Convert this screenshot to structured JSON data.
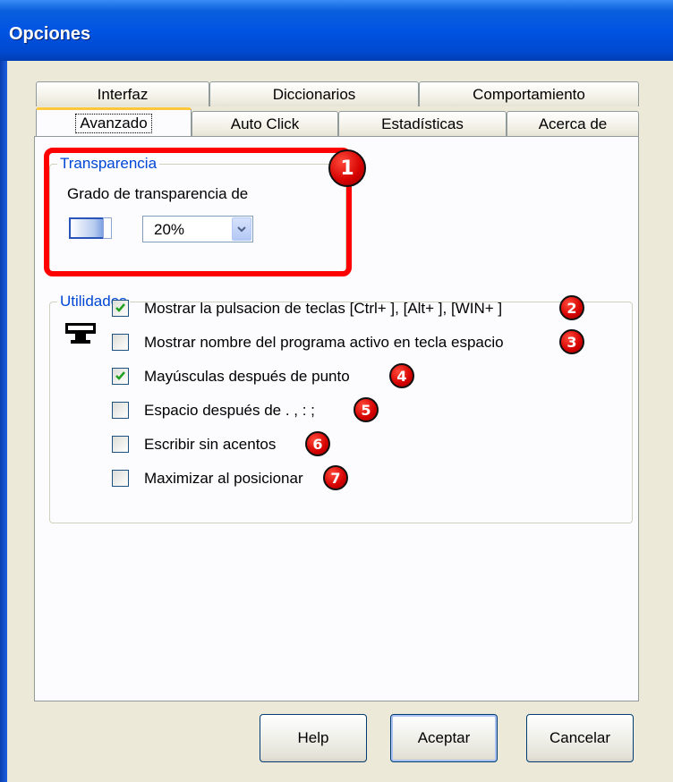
{
  "window": {
    "title": "Opciones"
  },
  "tabs": {
    "row_back": [
      "Interfaz",
      "Diccionarios",
      "Comportamiento"
    ],
    "row_front": [
      "Avanzado",
      "Auto Click",
      "Estadísticas",
      "Acerca de"
    ],
    "active": "Avanzado"
  },
  "transparency": {
    "legend": "Transparencia",
    "label": "Grado de transparencia de",
    "selected_value": "20%",
    "badge": "1"
  },
  "utilities": {
    "legend": "Utilidades",
    "options": [
      {
        "label": "Mostrar la pulsacion de teclas [Ctrl+ ], [Alt+ ], [WIN+ ]",
        "checked": true,
        "badge": "2"
      },
      {
        "label": "Mostrar nombre del programa activo en tecla espacio",
        "checked": false,
        "badge": "3"
      },
      {
        "label": "Mayúsculas después de punto",
        "checked": true,
        "badge": "4"
      },
      {
        "label": "Espacio después de . , : ;",
        "checked": false,
        "badge": "5"
      },
      {
        "label": "Escribir sin acentos",
        "checked": false,
        "badge": "6"
      },
      {
        "label": "Maximizar al posicionar",
        "checked": false,
        "badge": "7"
      }
    ]
  },
  "buttons": {
    "help": "Help",
    "accept": "Aceptar",
    "cancel": "Cancelar"
  },
  "colors": {
    "titlebar": "#0054e3",
    "legend": "#0046d5",
    "annotation": "#ff0000",
    "checkmark": "#21a121"
  },
  "icons": [
    "slider-icon",
    "chevron-down-icon",
    "monitor-icon",
    "checkmark-icon"
  ]
}
